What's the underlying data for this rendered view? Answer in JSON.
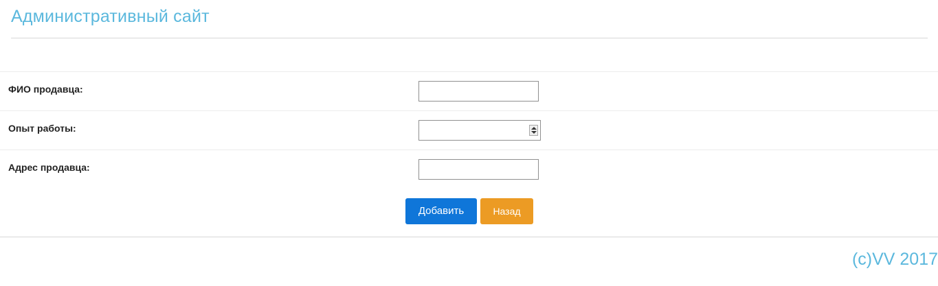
{
  "header": {
    "title": "Административный сайт"
  },
  "form": {
    "fields": [
      {
        "label": "ФИО продавца:",
        "value": "",
        "type": "text"
      },
      {
        "label": "Опыт работы:",
        "value": "",
        "type": "number"
      },
      {
        "label": "Адрес продавца:",
        "value": "",
        "type": "text"
      }
    ],
    "add_button": "Добавить",
    "back_button": "Назад"
  },
  "colors": {
    "title": "#5bb8dd",
    "add_button": "#0f76d9",
    "back_button": "#ec9b24"
  },
  "footer": {
    "copyright": "(c)VV 2017"
  }
}
